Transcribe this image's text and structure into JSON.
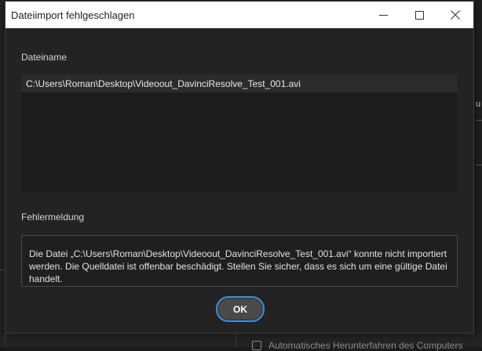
{
  "window": {
    "title": "Dateiimport fehlgeschlagen",
    "controls": {
      "minimize_icon": "minimize-icon",
      "maximize_icon": "maximize-icon",
      "close_icon": "close-icon"
    }
  },
  "filename_section": {
    "label": "Dateiname",
    "files": [
      "C:\\Users\\Roman\\Desktop\\Videoout_DavinciResolve_Test_001.avi"
    ]
  },
  "error_section": {
    "label": "Fehlermeldung",
    "message": "Die Datei „C:\\Users\\Roman\\Desktop\\Videoout_DavinciResolve_Test_001.avi“ konnte nicht importiert werden. Die Quelldatei ist offenbar beschädigt. Stellen Sie sicher, dass es sich um eine gültige Datei handelt."
  },
  "buttons": {
    "ok_label": "OK"
  },
  "background": {
    "edge_text": "u",
    "checkbox_label": "Automatisches Herunterfahren des Computers"
  },
  "colors": {
    "dialog_bg": "#232323",
    "titlebar_bg": "#ffffff",
    "focus_ring": "#3a8de0"
  }
}
